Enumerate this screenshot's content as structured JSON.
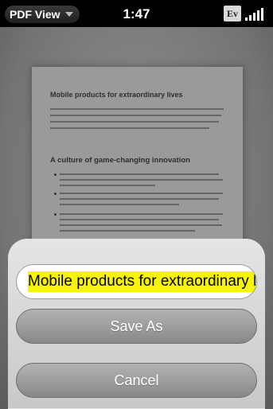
{
  "status_bar": {
    "app_menu_label": "PDF View",
    "time": "1:47",
    "ev_label": "Ev"
  },
  "document": {
    "title": "Mobile products for extraordinary lives",
    "section_heading": "A culture of game-changing innovation"
  },
  "save_dialog": {
    "filename_value": "Mobile products for extraordinary lives",
    "save_as_label": "Save As",
    "cancel_label": "Cancel"
  }
}
